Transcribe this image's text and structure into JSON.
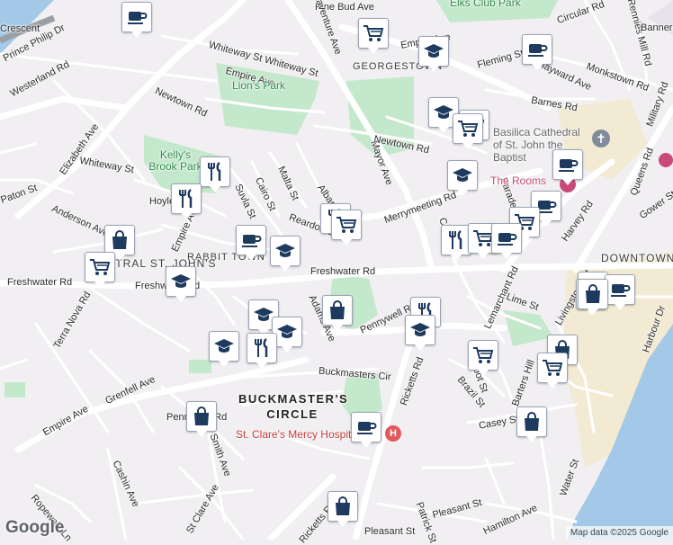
{
  "colors": {
    "background": "#f1eff2",
    "park": "#c4e8cc",
    "water": "#a3c8e8",
    "road": "#ffffff",
    "icon": "#1e3a5f",
    "hospital": "#e05a5a"
  },
  "labels": {
    "streets": [
      "Westerland Rd",
      "Elizabeth Ave",
      "Newtown Rd",
      "Whiteway St Whiteway St",
      "Pine Bud Ave",
      "Bonaventure Ave",
      "Empire Ave",
      "Fleming St",
      "Circular Rd",
      "Monkstown Rd",
      "Hayward Ave",
      "Barnes Rd",
      "Military Rd",
      "Whiteway St",
      "Malta St",
      "Cairo St",
      "Suvla St",
      "Paton St",
      "Anderson Ave",
      "Empire Ave",
      "Mayor Ave",
      "Newtown Rd",
      "Merrymeeting Rd",
      "Freshwater Rd",
      "Freshwater Rd",
      "Freshwater Rd",
      "Adams Ave",
      "Pennywell Rd",
      "Lemarchant Rd",
      "Lime St",
      "Livingstone St",
      "Harvey Rd",
      "Queens Rd",
      "Gower St",
      "Harbour Dr",
      "Terra Nova Rd",
      "Grenfell Ave",
      "Empire Ave",
      "Buckmasters Cir",
      "Ricketts Rd",
      "Brazil St",
      "Barters Hill",
      "Casey St",
      "Pennywell Rd",
      "Smith Ave",
      "Cashin Ave",
      "Ropewalk Ln",
      "St Clare Ave",
      "Ricketts Rd",
      "Pleasant St",
      "Pleasant St",
      "Hamilton Ave",
      "Water St",
      "Parade St",
      "Cook St",
      "Albany St",
      "Reardon St",
      "Hoyles Ave",
      "Prince Philip Dr",
      "Empire Ave",
      "Cabot St",
      "Patrick St",
      "Rennies Mill Rd",
      "Bannerman"
    ],
    "parks": [
      "Elks Club Park",
      "Lion's Park",
      "Kelly's Brook Park"
    ],
    "areas": [
      "GEORGESTOWN",
      "RABBIT TOWN",
      "CENTRAL ST. JOHN'S",
      "DOWNTOWN"
    ],
    "big_area": "BUCKMASTER'S CIRCLE",
    "pois": [
      "Basilica Cathedral of St. John the Baptist",
      "The Rooms",
      "St. Clare's Mercy Hospital"
    ],
    "crescent": "Crescent"
  },
  "footer": {
    "logo": "Google",
    "credit": "Map data ©2025 Google"
  },
  "pins": [
    {
      "type": "cafe"
    },
    {
      "type": "grocery"
    },
    {
      "type": "school"
    },
    {
      "type": "cafe"
    },
    {
      "type": "school"
    },
    {
      "type": "grocery"
    },
    {
      "type": "grocery"
    },
    {
      "type": "restaurant"
    },
    {
      "type": "restaurant"
    },
    {
      "type": "school"
    },
    {
      "type": "cafe"
    },
    {
      "type": "restaurant"
    },
    {
      "type": "grocery"
    },
    {
      "type": "cafe"
    },
    {
      "type": "school"
    },
    {
      "type": "shopping"
    },
    {
      "type": "grocery"
    },
    {
      "type": "school"
    },
    {
      "type": "cafe"
    },
    {
      "type": "restaurant"
    },
    {
      "type": "grocery"
    },
    {
      "type": "grocery"
    },
    {
      "type": "cafe"
    },
    {
      "type": "cafe"
    },
    {
      "type": "shopping"
    },
    {
      "type": "cafe"
    },
    {
      "type": "shopping"
    },
    {
      "type": "school"
    },
    {
      "type": "school"
    },
    {
      "type": "school"
    },
    {
      "type": "restaurant"
    },
    {
      "type": "shopping"
    },
    {
      "type": "restaurant"
    },
    {
      "type": "school"
    },
    {
      "type": "grocery"
    },
    {
      "type": "shopping"
    },
    {
      "type": "grocery"
    },
    {
      "type": "shopping"
    },
    {
      "type": "cafe"
    },
    {
      "type": "shopping"
    },
    {
      "type": "shopping"
    }
  ]
}
